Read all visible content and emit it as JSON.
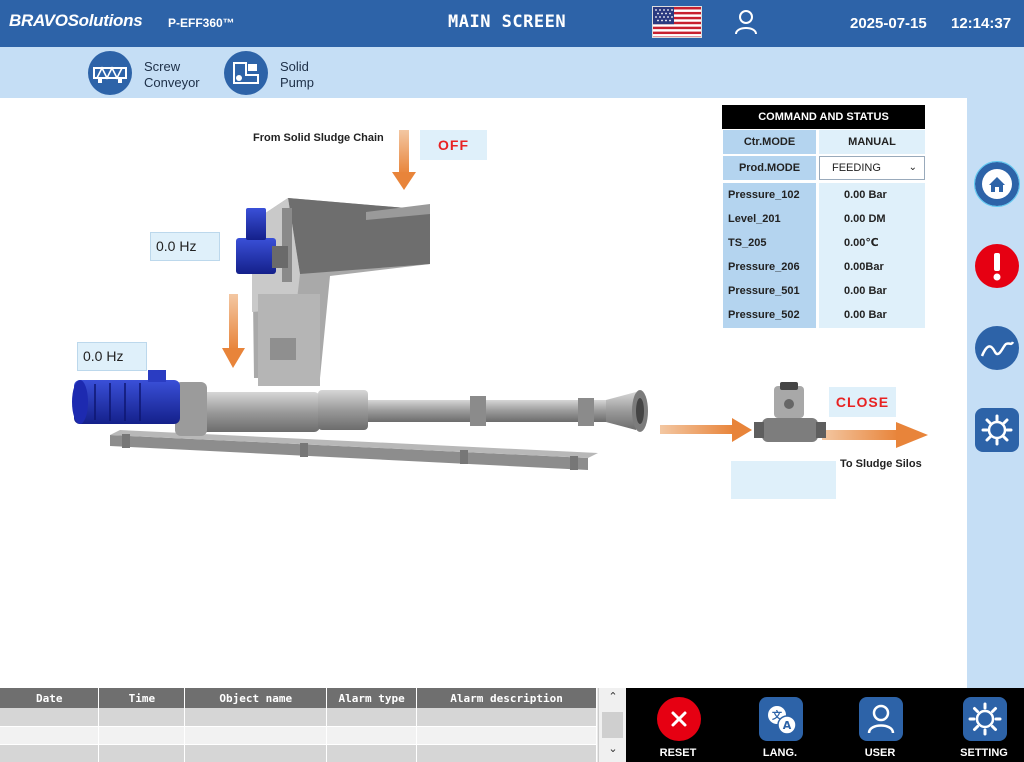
{
  "header": {
    "brand_primary": "BRAVO",
    "brand_secondary": "Solutions",
    "model": "P-EFF360™",
    "title": "MAIN SCREEN",
    "date": "2025-07-15",
    "time": "12:14:37",
    "flag_icon": "us-flag-icon",
    "user_icon": "user-icon"
  },
  "toolbar": {
    "screw_conveyor": "Screw\nConveyor",
    "solid_pump": "Solid\nPump"
  },
  "process": {
    "inlet_label": "From Solid Sludge Chain",
    "inlet_state": "OFF",
    "conveyor_hz": "0.0 Hz",
    "pump_hz": "0.0 Hz",
    "valve_state": "CLOSE",
    "outlet_label": "To Sludge Silos"
  },
  "command": {
    "title": "COMMAND AND STATUS",
    "ctr_mode_label": "Ctr.MODE",
    "ctr_mode_value": "MANUAL",
    "prod_mode_label": "Prod.MODE",
    "prod_mode_value": "FEEDING",
    "readings": [
      {
        "name": "Pressure_102",
        "value": "0.00  Bar"
      },
      {
        "name": "Level_201",
        "value": "0.00 DM"
      },
      {
        "name": "TS_205",
        "value": "0.00℃"
      },
      {
        "name": "Pressure_206",
        "value": "0.00Bar"
      },
      {
        "name": "Pressure_501",
        "value": "0.00  Bar"
      },
      {
        "name": "Pressure_502",
        "value": "0.00  Bar"
      }
    ]
  },
  "alarm_table": {
    "columns": [
      "Date",
      "Time",
      "Object name",
      "Alarm type",
      "Alarm description"
    ],
    "rows": []
  },
  "actions": {
    "reset": "RESET",
    "lang": "LANG.",
    "user": "USER",
    "setting": "SETTING"
  },
  "colors": {
    "header_bg": "#2d63a8",
    "panel_bg": "#c5def5",
    "alarm_red": "#e82222",
    "arrow_orange": "#e8843a"
  }
}
